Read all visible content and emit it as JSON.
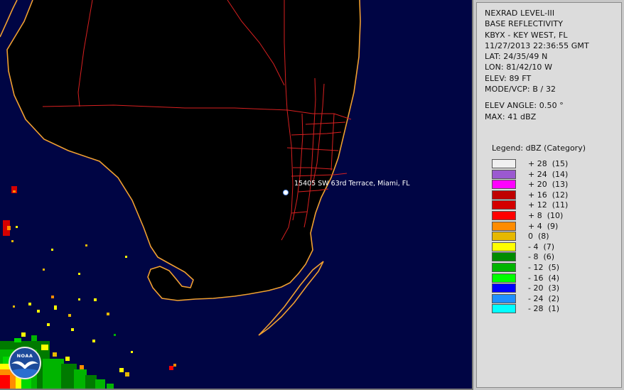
{
  "info": {
    "product": "NEXRAD LEVEL-III",
    "product_type": "BASE REFLECTIVITY",
    "station": "KBYX - KEY WEST, FL",
    "datetime": "11/27/2013 22:36:55 GMT",
    "lat": "LAT: 24/35/49 N",
    "lon": "LON: 81/42/10 W",
    "elev": "ELEV: 89 FT",
    "mode": "MODE/VCP: B / 32",
    "elev_angle": "ELEV ANGLE: 0.50 °",
    "max": "MAX: 41 dBZ"
  },
  "legend": {
    "title": "Legend: dBZ (Category)",
    "items": [
      {
        "label": "+ 28  (15)",
        "color": "#f0f0f0"
      },
      {
        "label": "+ 24  (14)",
        "color": "#9b59d0"
      },
      {
        "label": "+ 20  (13)",
        "color": "#ff00ff"
      },
      {
        "label": "+ 16  (12)",
        "color": "#c00000"
      },
      {
        "label": "+ 12  (11)",
        "color": "#d40000"
      },
      {
        "label": "+ 8  (10)",
        "color": "#ff0000"
      },
      {
        "label": "+ 4  (9)",
        "color": "#ff8c00"
      },
      {
        "label": "0  (8)",
        "color": "#e6b800"
      },
      {
        "label": "- 4  (7)",
        "color": "#ffff00"
      },
      {
        "label": "- 8  (6)",
        "color": "#008c00"
      },
      {
        "label": "- 12  (5)",
        "color": "#00b400"
      },
      {
        "label": "- 16  (4)",
        "color": "#00ff00"
      },
      {
        "label": "- 20  (3)",
        "color": "#0000ff"
      },
      {
        "label": "- 24  (2)",
        "color": "#1e90ff"
      },
      {
        "label": "- 28  (1)",
        "color": "#00ffff"
      }
    ]
  },
  "map": {
    "location_label": "15405 SW 63rd Terrace, Miami, FL",
    "logo_text": "NOAA",
    "background_color": "#000544",
    "coast_color": "#f0a030",
    "road_color": "#d82020"
  }
}
